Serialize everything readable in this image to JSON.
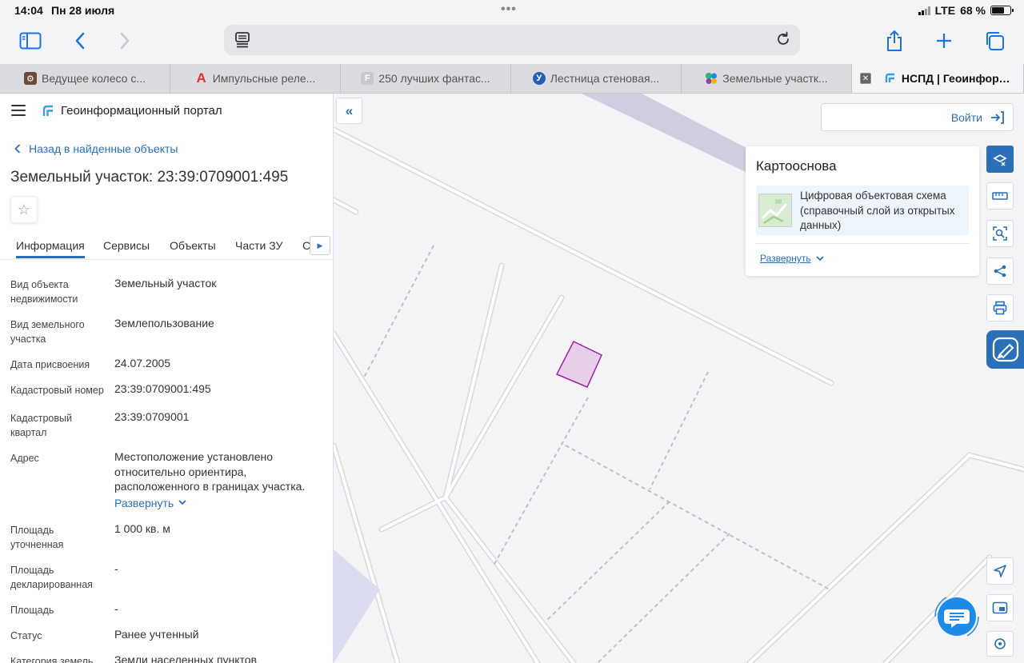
{
  "status_bar": {
    "time": "14:04",
    "date": "Пн 28 июля",
    "network": "LTE",
    "battery_percent": "68 %",
    "battery_level": 0.68
  },
  "browser": {
    "icons": [
      "sidebar-icon",
      "back-icon",
      "forward-icon",
      "reader-icon",
      "reload-icon",
      "share-icon",
      "new-tab-icon",
      "tabs-icon"
    ],
    "tabs": [
      {
        "title": "Ведущее колесо с...",
        "favicon": "wheel"
      },
      {
        "title": "Импульсные реле...",
        "favicon": "A"
      },
      {
        "title": "250 лучших фантас...",
        "favicon": "F"
      },
      {
        "title": "Лестница стеновая...",
        "favicon": "У"
      },
      {
        "title": "Земельные участк...",
        "favicon": "dots"
      },
      {
        "title": "НСПД | Геоинформ...",
        "favicon": "nspd",
        "active": true
      }
    ]
  },
  "panel": {
    "app_title": "Геоинформационный портал",
    "back_link": "Назад в найденные объекты",
    "object_title": "Земельный участок: 23:39:0709001:495",
    "tabs": [
      "Информация",
      "Сервисы",
      "Объекты",
      "Части ЗУ",
      "Св"
    ],
    "active_tab": "Информация",
    "fields": [
      {
        "label": "Вид объекта недвижимости",
        "value": "Земельный участок"
      },
      {
        "label": "Вид земельного участка",
        "value": "Землепользование"
      },
      {
        "label": "Дата присвоения",
        "value": "24.07.2005"
      },
      {
        "label": "Кадастровый номер",
        "value": "23:39:0709001:495"
      },
      {
        "label": "Кадастровый квартал",
        "value": "23:39:0709001"
      },
      {
        "label": "Адрес",
        "value": "Местоположение установлено относительно ориентира, расположенного в границах участка.",
        "expand": "Развернуть"
      },
      {
        "label": "Площадь уточненная",
        "value": "1 000 кв. м"
      },
      {
        "label": "Площадь декларированная",
        "value": "-"
      },
      {
        "label": "Площадь",
        "value": "-"
      },
      {
        "label": "Статус",
        "value": "Ранее учтенный"
      },
      {
        "label": "Категория земель",
        "value": "Земли населенных пунктов"
      }
    ]
  },
  "map": {
    "login_label": "Войти",
    "basemap": {
      "title": "Картооснова",
      "item": "Цифровая объектовая схема (справочный слой из открытых данных)",
      "expand": "Развернуть"
    },
    "tool_icons": [
      "layers-icon",
      "ruler-icon",
      "select-area-icon",
      "share-icon",
      "print-icon",
      "gosuslugi-icon"
    ],
    "bottom_icons": [
      "locate-icon",
      "minimap-icon",
      "geolocation-icon",
      "chat-icon"
    ],
    "colors": {
      "accent": "#2a6fb8",
      "parcel_fill": "#e7cfe8",
      "parcel_stroke": "#a01fa8"
    }
  }
}
